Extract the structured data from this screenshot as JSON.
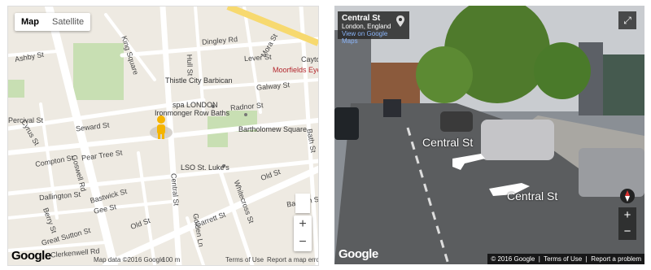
{
  "map": {
    "type_control": {
      "map_label": "Map",
      "satellite_label": "Satellite"
    },
    "streets": [
      "Ashby St",
      "King Square",
      "Dingley Rd",
      "Hull St",
      "Lever St",
      "Galway St",
      "Thistle City Barbican",
      "Ironmonger Row Baths",
      "spa LONDON",
      "Radnor St",
      "Bartholomew Square",
      "Seward St",
      "Percival St",
      "Cyrus St",
      "Compton St",
      "Pear Tree St",
      "Goswell Rd",
      "LSO St. Luke's",
      "Old St",
      "Dallington St",
      "Bastwick St",
      "Gee St",
      "Central St",
      "Whitecross St",
      "Golden Ln",
      "Garrett St",
      "Berry St",
      "Great Sutton St",
      "Clerkenwell Rd",
      "Bath St",
      "Baldwin St",
      "Moorfields Eye H",
      "Lever St",
      "Mora St",
      "Cayto",
      "Old St",
      "St"
    ],
    "footer": {
      "data": "Map data ©2016 Google",
      "scale": "100 m",
      "terms": "Terms of Use",
      "report": "Report a map error"
    },
    "logo": "Google"
  },
  "street_view": {
    "title": "Central St",
    "subtitle": "London, England",
    "link": "View on Google Maps",
    "labels": [
      "Central St",
      "Central St"
    ],
    "footer": {
      "copyright": "© 2016 Google",
      "terms": "Terms of Use",
      "report": "Report a problem"
    },
    "logo": "Google"
  }
}
